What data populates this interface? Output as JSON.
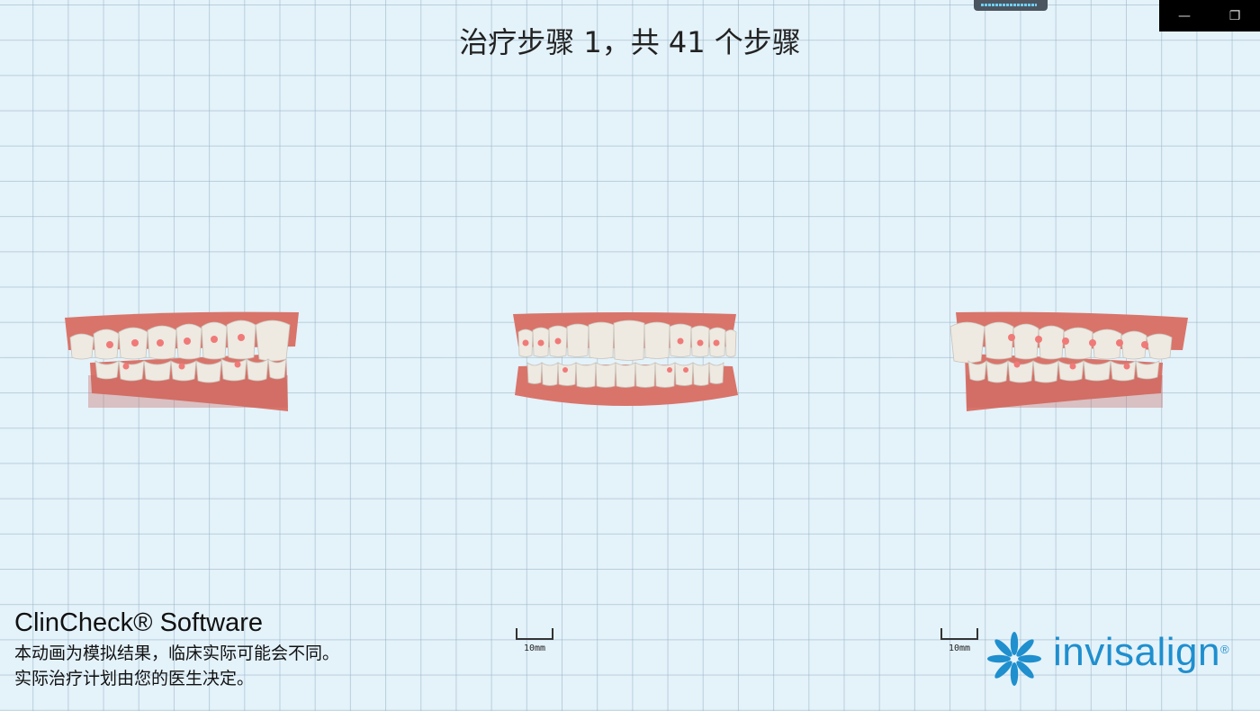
{
  "header": {
    "title": "治疗步骤 1，共 41 个步骤"
  },
  "window": {
    "minimize_icon": "minimize-icon",
    "restore_icon": "restore-icon"
  },
  "views": [
    {
      "name": "right-lateral-view"
    },
    {
      "name": "frontal-view"
    },
    {
      "name": "left-lateral-view"
    }
  ],
  "scale": {
    "label": "10mm"
  },
  "footer": {
    "brand": "ClinCheck® Software",
    "disclaimer_line1": "本动画为模拟结果，临床实际可能会不同。",
    "disclaimer_line2": "实际治疗计划由您的医生决定。"
  },
  "logo": {
    "text": "invisalign",
    "registered": "®",
    "icon": "invisalign-star-icon"
  },
  "colors": {
    "gum": "#d9746a",
    "tooth": "#eee9e1",
    "attachment": "#f07a78",
    "grid_background": "#e4f2fa",
    "brand_blue": "#1f8fce"
  }
}
